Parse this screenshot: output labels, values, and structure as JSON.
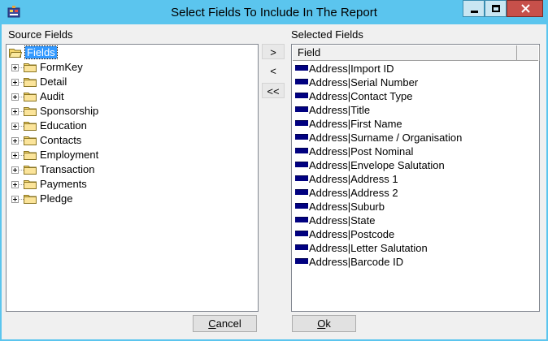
{
  "window": {
    "title": "Select Fields To Include In The Report",
    "controls": {
      "minimize": "minimize-icon",
      "maximize": "maximize-icon",
      "close": "close-icon"
    }
  },
  "source": {
    "label": "Source Fields",
    "root": "Fields",
    "nodes": [
      "FormKey",
      "Detail",
      "Audit",
      "Sponsorship",
      "Education",
      "Contacts",
      "Employment",
      "Transaction",
      "Payments",
      "Pledge"
    ]
  },
  "buttons": {
    "add": ">",
    "remove": "<",
    "remove_all": "<<"
  },
  "selected": {
    "label": "Selected Fields",
    "column_header": "Field",
    "items": [
      "Address|Import ID",
      "Address|Serial Number",
      "Address|Contact Type",
      "Address|Title",
      "Address|First Name",
      "Address|Surname / Organisation",
      "Address|Post Nominal",
      "Address|Envelope Salutation",
      "Address|Address 1",
      "Address|Address 2",
      "Address|Suburb",
      "Address|State",
      "Address|Postcode",
      "Address|Letter Salutation",
      "Address|Barcode ID"
    ]
  },
  "footer": {
    "cancel_accel": "C",
    "cancel_rest": "ancel",
    "ok_accel": "O",
    "ok_rest": "k"
  },
  "colors": {
    "titlebar": "#5bc5ee",
    "selection": "#3399ff",
    "field_icon": "#000080",
    "close": "#c7504a"
  }
}
